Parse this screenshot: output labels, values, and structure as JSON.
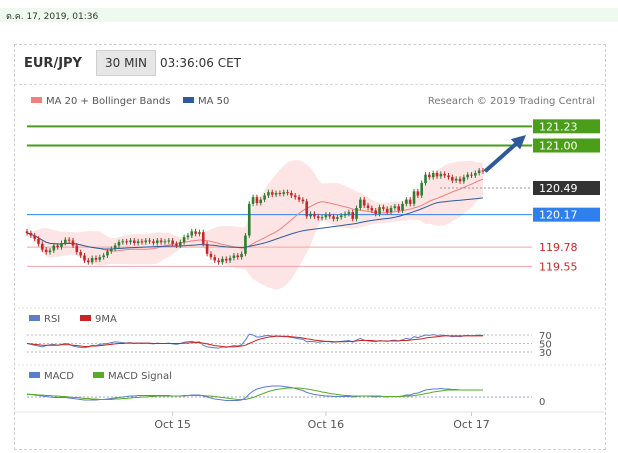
{
  "timestamp": "ต.ค. 17, 2019, 01:36",
  "header": {
    "pair": "EUR/JPY",
    "timeframe": "30 MIN",
    "time": "03:36:06 CET"
  },
  "legend": {
    "ma20": "MA 20 + Bollinger Bands",
    "ma50": "MA 50",
    "credit": "Research © 2019 Trading Central"
  },
  "colors": {
    "up": "#2e7d32",
    "down": "#c62828",
    "ma20": "#f08080",
    "ma50": "#2f5a9a",
    "band": "#fde0e0",
    "green": "#4a9e19",
    "blueTag": "#2f80ed",
    "darkTag": "#333333",
    "arrow": "#2f5a9a",
    "rsi": "#5b7ec9",
    "rsi9": "#cc2222",
    "macd": "#5b7ec9",
    "signal": "#5aaa2a"
  },
  "levels": [
    {
      "value": 121.23,
      "label": "121.23",
      "kind": "target"
    },
    {
      "value": 121.0,
      "label": "121.00",
      "kind": "target"
    },
    {
      "value": 120.49,
      "label": "120.49",
      "kind": "last"
    },
    {
      "value": 120.17,
      "label": "120.17",
      "kind": "pivot"
    },
    {
      "value": 119.78,
      "label": "119.78",
      "kind": "support"
    },
    {
      "value": 119.55,
      "label": "119.55",
      "kind": "support"
    }
  ],
  "rsi": {
    "labels": {
      "rsi": "RSI",
      "ma": "9MA"
    },
    "levels": [
      "70",
      "50",
      "30"
    ]
  },
  "macd": {
    "labels": {
      "macd": "MACD",
      "signal": "MACD Signal"
    },
    "zero": "0"
  },
  "chart_data": {
    "type": "candlestick",
    "xlabels": [
      "Oct 15",
      "Oct 16",
      "Oct 17"
    ],
    "price_range": [
      119.05,
      121.45
    ],
    "close": [
      119.95,
      119.92,
      119.88,
      119.82,
      119.75,
      119.72,
      119.74,
      119.8,
      119.78,
      119.83,
      119.87,
      119.86,
      119.8,
      119.72,
      119.68,
      119.62,
      119.6,
      119.65,
      119.63,
      119.66,
      119.68,
      119.73,
      119.76,
      119.8,
      119.84,
      119.85,
      119.84,
      119.86,
      119.83,
      119.85,
      119.84,
      119.86,
      119.85,
      119.83,
      119.86,
      119.84,
      119.85,
      119.86,
      119.82,
      119.8,
      119.84,
      119.9,
      119.92,
      119.97,
      119.94,
      119.96,
      119.82,
      119.7,
      119.66,
      119.62,
      119.6,
      119.64,
      119.62,
      119.65,
      119.68,
      119.66,
      119.7,
      119.92,
      120.3,
      120.38,
      120.31,
      120.35,
      120.4,
      120.44,
      120.41,
      120.43,
      120.42,
      120.44,
      120.43,
      120.4,
      120.38,
      120.35,
      120.33,
      120.15,
      120.18,
      120.15,
      120.13,
      120.14,
      120.17,
      120.15,
      120.12,
      120.14,
      120.16,
      120.18,
      120.2,
      120.12,
      120.25,
      120.35,
      120.28,
      120.25,
      120.22,
      120.18,
      120.26,
      120.24,
      120.2,
      120.25,
      120.27,
      120.22,
      120.3,
      120.35,
      120.3,
      120.45,
      120.4,
      120.55,
      120.65,
      120.62,
      120.67,
      120.63,
      120.66,
      120.64,
      120.62,
      120.58,
      120.6,
      120.57,
      120.62,
      120.65,
      120.64,
      120.67,
      120.7,
      120.69
    ],
    "series": [
      {
        "name": "RSI",
        "values": [
          50,
          48,
          46,
          44,
          42,
          45,
          47,
          48,
          46,
          48,
          50,
          49,
          44,
          42,
          41,
          40,
          42,
          46,
          45,
          48,
          49,
          50,
          52,
          54,
          53,
          52,
          51,
          52,
          50,
          51,
          50,
          51,
          50,
          49,
          51,
          50,
          50,
          51,
          49,
          48,
          50,
          53,
          54,
          55,
          53,
          54,
          46,
          42,
          41,
          40,
          39,
          42,
          41,
          43,
          45,
          44,
          47,
          58,
          72,
          70,
          65,
          66,
          68,
          69,
          67,
          68,
          67,
          66,
          66,
          64,
          63,
          61,
          60,
          54,
          55,
          54,
          53,
          54,
          55,
          54,
          53,
          54,
          55,
          56,
          57,
          53,
          58,
          62,
          58,
          56,
          55,
          54,
          57,
          56,
          55,
          57,
          58,
          56,
          59,
          62,
          60,
          66,
          64,
          67,
          70,
          69,
          71,
          69,
          70,
          69,
          68,
          66,
          67,
          66,
          68,
          69,
          68,
          69,
          70,
          69
        ]
      },
      {
        "name": "9MA",
        "values": [
          50,
          49,
          48,
          47,
          46,
          46,
          46,
          46,
          46,
          47,
          47,
          47,
          46,
          45,
          44,
          43,
          43,
          44,
          44,
          45,
          46,
          47,
          48,
          49,
          50,
          50,
          51,
          51,
          51,
          51,
          51,
          51,
          51,
          50,
          50,
          50,
          50,
          50,
          50,
          50,
          50,
          51,
          51,
          52,
          52,
          52,
          51,
          49,
          47,
          45,
          44,
          43,
          42,
          42,
          42,
          43,
          44,
          46,
          50,
          54,
          58,
          61,
          63,
          65,
          66,
          67,
          67,
          67,
          67,
          66,
          65,
          64,
          63,
          61,
          60,
          58,
          57,
          56,
          55,
          55,
          54,
          54,
          54,
          54,
          55,
          55,
          56,
          57,
          57,
          57,
          57,
          56,
          56,
          56,
          56,
          56,
          56,
          56,
          57,
          57,
          58,
          59,
          60,
          61,
          63,
          64,
          65,
          66,
          67,
          68,
          68,
          68,
          68,
          68,
          68,
          68,
          68,
          68,
          68,
          68
        ]
      },
      {
        "name": "MACD",
        "values": [
          0.06,
          0.05,
          0.04,
          0.03,
          0.02,
          0.01,
          0.0,
          -0.01,
          -0.01,
          -0.01,
          -0.01,
          -0.02,
          -0.03,
          -0.04,
          -0.05,
          -0.06,
          -0.06,
          -0.06,
          -0.06,
          -0.05,
          -0.05,
          -0.04,
          -0.03,
          -0.02,
          -0.01,
          0.0,
          0.01,
          0.02,
          0.02,
          0.03,
          0.03,
          0.03,
          0.03,
          0.03,
          0.03,
          0.03,
          0.03,
          0.03,
          0.02,
          0.02,
          0.02,
          0.03,
          0.03,
          0.04,
          0.04,
          0.04,
          0.02,
          0.0,
          -0.02,
          -0.04,
          -0.05,
          -0.06,
          -0.07,
          -0.07,
          -0.07,
          -0.07,
          -0.06,
          -0.02,
          0.06,
          0.12,
          0.16,
          0.18,
          0.2,
          0.21,
          0.22,
          0.22,
          0.22,
          0.21,
          0.2,
          0.19,
          0.17,
          0.15,
          0.13,
          0.09,
          0.07,
          0.05,
          0.04,
          0.03,
          0.02,
          0.02,
          0.01,
          0.01,
          0.01,
          0.01,
          0.01,
          0.0,
          0.01,
          0.02,
          0.02,
          0.02,
          0.01,
          0.0,
          0.01,
          0.01,
          0.0,
          0.01,
          0.01,
          0.01,
          0.02,
          0.04,
          0.04,
          0.07,
          0.08,
          0.11,
          0.14,
          0.15,
          0.16,
          0.16,
          0.17,
          0.16,
          0.16,
          0.15,
          0.15,
          0.14,
          0.14,
          0.14,
          0.14,
          0.14,
          0.14,
          0.14
        ]
      },
      {
        "name": "MACD Signal",
        "values": [
          0.05,
          0.05,
          0.05,
          0.04,
          0.04,
          0.03,
          0.03,
          0.02,
          0.02,
          0.01,
          0.01,
          0.0,
          -0.01,
          -0.01,
          -0.02,
          -0.03,
          -0.03,
          -0.04,
          -0.04,
          -0.05,
          -0.05,
          -0.05,
          -0.05,
          -0.04,
          -0.04,
          -0.03,
          -0.03,
          -0.02,
          -0.01,
          -0.01,
          0.0,
          0.0,
          0.01,
          0.01,
          0.02,
          0.02,
          0.02,
          0.02,
          0.02,
          0.02,
          0.02,
          0.02,
          0.03,
          0.03,
          0.03,
          0.03,
          0.03,
          0.02,
          0.02,
          0.01,
          0.0,
          -0.01,
          -0.02,
          -0.03,
          -0.04,
          -0.05,
          -0.05,
          -0.05,
          -0.03,
          -0.01,
          0.02,
          0.05,
          0.08,
          0.11,
          0.13,
          0.15,
          0.16,
          0.17,
          0.18,
          0.18,
          0.18,
          0.18,
          0.17,
          0.16,
          0.15,
          0.13,
          0.12,
          0.1,
          0.09,
          0.07,
          0.06,
          0.05,
          0.04,
          0.03,
          0.03,
          0.02,
          0.02,
          0.02,
          0.02,
          0.02,
          0.02,
          0.02,
          0.02,
          0.01,
          0.01,
          0.01,
          0.01,
          0.01,
          0.01,
          0.02,
          0.02,
          0.03,
          0.04,
          0.05,
          0.07,
          0.08,
          0.1,
          0.11,
          0.12,
          0.13,
          0.14,
          0.14,
          0.14,
          0.14,
          0.14,
          0.14,
          0.14,
          0.14,
          0.14,
          0.14
        ]
      }
    ]
  }
}
